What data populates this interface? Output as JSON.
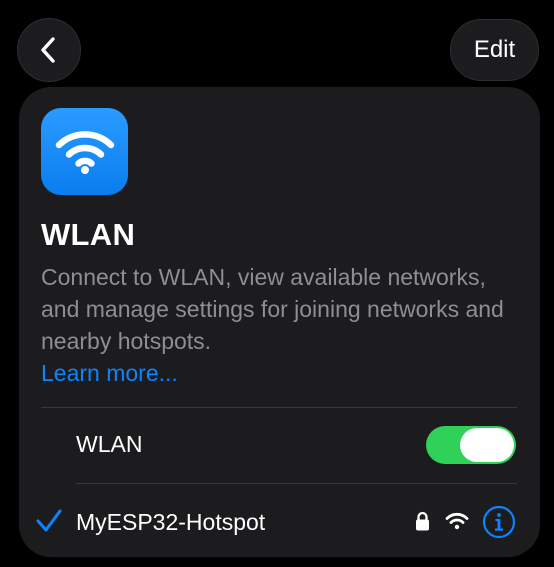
{
  "nav": {
    "back_icon": "chevron-left-icon",
    "edit_label": "Edit"
  },
  "header": {
    "app_icon": "wifi-icon",
    "title": "WLAN",
    "description": "Connect to WLAN, view available networks, and manage settings for joining networks and nearby hotspots.",
    "learn_more": "Learn more..."
  },
  "wlan_toggle": {
    "label": "WLAN",
    "on": true
  },
  "connected_network": {
    "name": "MyESP32-Hotspot",
    "status_icon": "checkmark-icon",
    "secured": true,
    "lock_icon": "lock-icon",
    "signal_icon": "wifi-signal-icon",
    "info_icon": "info-icon"
  },
  "colors": {
    "background": "#000000",
    "card": "#1c1c1e",
    "accent": "#0a84ff",
    "toggle_on": "#30d158",
    "secondary_text": "#8e8e93",
    "icon_gradient_top": "#2a9bff",
    "icon_gradient_bottom": "#0a7df0"
  }
}
